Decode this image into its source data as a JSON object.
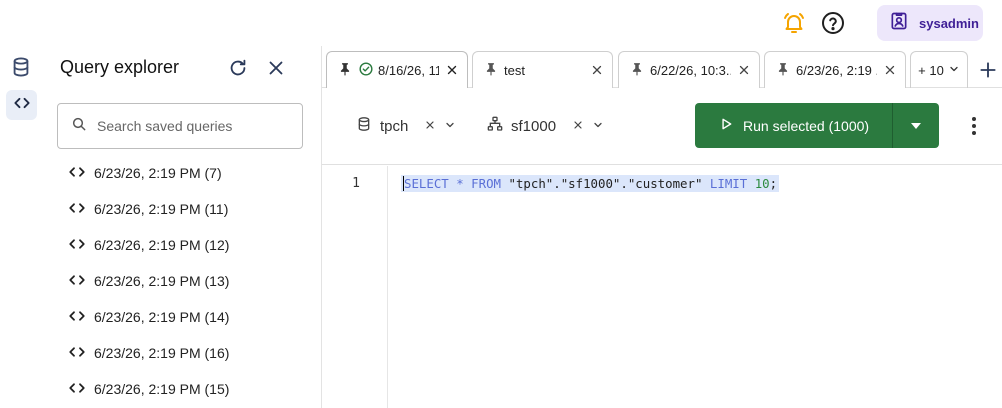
{
  "header": {
    "username": "sysadmin",
    "icons": [
      "bell-alert-icon",
      "help-icon",
      "user-badge-icon"
    ]
  },
  "colors": {
    "run_green": "#2b7a3f",
    "user_bg": "#ede7fb",
    "accent_bell": "#f5a400"
  },
  "explorer": {
    "title": "Query explorer",
    "search_placeholder": "Search saved queries",
    "items": [
      {
        "label": "6/23/26, 2:19 PM (7)"
      },
      {
        "label": "6/23/26, 2:19 PM (11)"
      },
      {
        "label": "6/23/26, 2:19 PM (12)"
      },
      {
        "label": "6/23/26, 2:19 PM (13)"
      },
      {
        "label": "6/23/26, 2:19 PM (14)"
      },
      {
        "label": "6/23/26, 2:19 PM (16)"
      },
      {
        "label": "6/23/26, 2:19 PM (15)"
      }
    ]
  },
  "tabs": [
    {
      "label": "8/16/26, 11...",
      "status": "success"
    },
    {
      "label": "test"
    },
    {
      "label": "6/22/26, 10:3..."
    },
    {
      "label": "6/23/26, 2:19 ..."
    }
  ],
  "more_tabs": "+ 10",
  "toolbar": {
    "catalog": "tpch",
    "schema": "sf1000",
    "run_label": "Run selected (1000)"
  },
  "editor": {
    "line_number": "1",
    "kw_select": "SELECT",
    "star": "*",
    "kw_from": "FROM",
    "table": "\"tpch\".\"sf1000\".\"customer\"",
    "kw_limit": "LIMIT",
    "limit_value": "10",
    "semicolon": ";"
  }
}
